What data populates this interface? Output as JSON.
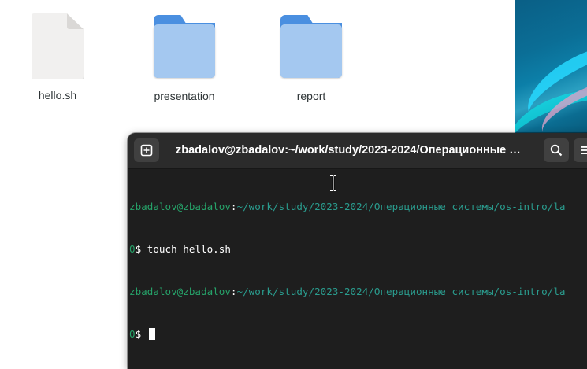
{
  "desktop": {
    "files": [
      {
        "name": "hello.sh",
        "kind": "document"
      },
      {
        "name": "presentation",
        "kind": "folder"
      },
      {
        "name": "report",
        "kind": "folder"
      }
    ]
  },
  "terminal": {
    "title": "zbadalov@zbadalov:~/work/study/2023-2024/Операционные …",
    "new_tab_icon": "new-tab-icon",
    "search_icon": "search-icon",
    "menu_icon": "hamburger-menu-icon",
    "lines": [
      {
        "user": "zbadalov@zbadalov",
        "sep": ":",
        "path": "~/work/study/2023-2024/Операционные системы/os-intro/la",
        "prompt_num": "0",
        "prompt_sym": "$ ",
        "command": "touch hello.sh"
      },
      {
        "user": "zbadalov@zbadalov",
        "sep": ":",
        "path": "~/work/study/2023-2024/Операционные системы/os-intro/la",
        "prompt_num": "0",
        "prompt_sym": "$ ",
        "command": ""
      }
    ]
  },
  "colors": {
    "terminal_bg": "#1e1e1e",
    "titlebar_bg": "#2b2b2b",
    "prompt_user": "#26a269",
    "prompt_path": "#2a9c8e",
    "folder_blue": "#4a8fe0",
    "folder_light": "#a4c8f0"
  }
}
